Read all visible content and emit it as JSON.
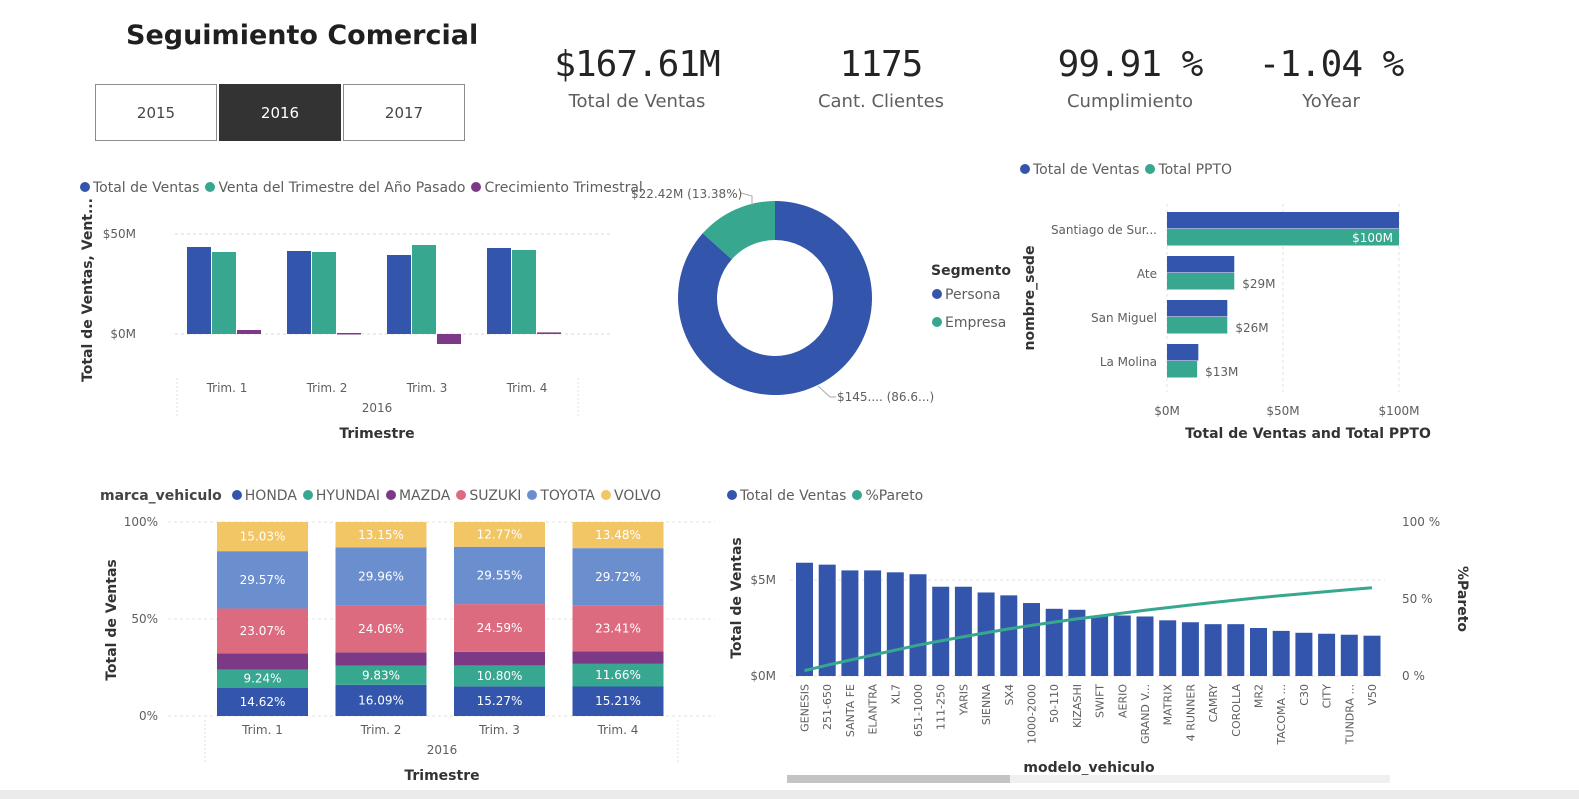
{
  "header": {
    "title": "Seguimiento Comercial"
  },
  "slicer": {
    "options": [
      "2015",
      "2016",
      "2017"
    ],
    "selected": "2016"
  },
  "kpis": [
    {
      "value": "$167.61M",
      "label": "Total de Ventas"
    },
    {
      "value": "1175",
      "label": "Cant. Clientes"
    },
    {
      "value": "99.91 %",
      "label": "Cumplimiento"
    },
    {
      "value": "-1.04 %",
      "label": "YoYear"
    }
  ],
  "colors": {
    "blue": "#3356ac",
    "teal": "#38a78f",
    "purple": "#7c3a86",
    "pink": "#dd6b7f",
    "lightblue": "#6b8fce",
    "yellow": "#f2c664",
    "selected": "#333333"
  },
  "chart_data": [
    {
      "type": "bar",
      "xlabel": "Trimestre",
      "ylabel": "Total de Ventas, Vent...",
      "group_label": "2016",
      "categories": [
        "Trim. 1",
        "Trim. 2",
        "Trim. 3",
        "Trim. 4"
      ],
      "yticks": [
        "$50M",
        "$0M"
      ],
      "ylim": [
        -10,
        60
      ],
      "series": [
        {
          "name": "Total de Ventas",
          "values": [
            43.5,
            41.5,
            39.5,
            43
          ],
          "color": "#3356ac"
        },
        {
          "name": "Venta del Trimestre del Año Pasado",
          "values": [
            41,
            41,
            44.5,
            42
          ],
          "color": "#38a78f"
        },
        {
          "name": "Crecimiento Trimestral",
          "values": [
            2,
            0.5,
            -5,
            0.8
          ],
          "color": "#7c3a86"
        }
      ]
    },
    {
      "type": "pie",
      "legend_title": "Segmento",
      "slices": [
        {
          "name": "Persona",
          "value": 86.62,
          "label": "$145.... (86.6...)",
          "color": "#3356ac"
        },
        {
          "name": "Empresa",
          "value": 13.38,
          "label": "$22.42M (13.38%)",
          "color": "#38a78f"
        }
      ]
    },
    {
      "type": "bar",
      "orientation": "horizontal",
      "xlabel": "Total de Ventas and Total PPTO",
      "ylabel": "nombre_sede",
      "categories": [
        "Santiago de Sur...",
        "Ate",
        "San Miguel",
        "La Molina"
      ],
      "xticks": [
        "$0M",
        "$50M",
        "$100M"
      ],
      "xlim": [
        0,
        100
      ],
      "series": [
        {
          "name": "Total de Ventas",
          "values": [
            100,
            29,
            26,
            13.5
          ],
          "color": "#3356ac"
        },
        {
          "name": "Total PPTO",
          "values": [
            100,
            29,
            26,
            13
          ],
          "labels": [
            "$100M",
            "$29M",
            "$26M",
            "$13M"
          ],
          "color": "#38a78f"
        }
      ]
    },
    {
      "type": "bar",
      "stacked": "percent",
      "legend_title": "marca_vehiculo",
      "xlabel": "Trimestre",
      "ylabel": "Total de Ventas",
      "group_label": "2016",
      "categories": [
        "Trim. 1",
        "Trim. 2",
        "Trim. 3",
        "Trim. 4"
      ],
      "yticks": [
        "100%",
        "50%",
        "0%"
      ],
      "series": [
        {
          "name": "HONDA",
          "values": [
            14.62,
            16.09,
            15.27,
            15.21
          ],
          "labels": [
            "14.62%",
            "16.09%",
            "15.27%",
            "15.21%"
          ],
          "color": "#3356ac"
        },
        {
          "name": "HYUNDAI",
          "values": [
            9.24,
            9.83,
            10.8,
            11.66
          ],
          "labels": [
            "9.24%",
            "9.83%",
            "10.80%",
            "11.66%"
          ],
          "color": "#38a78f"
        },
        {
          "name": "MAZDA",
          "values": [
            8.47,
            6.91,
            7.02,
            6.52
          ],
          "labels": [
            "",
            "",
            "",
            ""
          ],
          "color": "#7c3a86"
        },
        {
          "name": "SUZUKI",
          "values": [
            23.07,
            24.06,
            24.59,
            23.41
          ],
          "labels": [
            "23.07%",
            "24.06%",
            "24.59%",
            "23.41%"
          ],
          "color": "#dd6b7f"
        },
        {
          "name": "TOYOTA",
          "values": [
            29.57,
            29.96,
            29.55,
            29.72
          ],
          "labels": [
            "29.57%",
            "29.96%",
            "29.55%",
            "29.72%"
          ],
          "color": "#6b8fce"
        },
        {
          "name": "VOLVO",
          "values": [
            15.03,
            13.15,
            12.77,
            13.48
          ],
          "labels": [
            "15.03%",
            "13.15%",
            "12.77%",
            "13.48%"
          ],
          "color": "#f2c664"
        }
      ]
    },
    {
      "type": "bar",
      "combo_line": true,
      "xlabel": "modelo_vehiculo",
      "ylabel": "Total de Ventas",
      "y2label": "%Pareto",
      "yticks": [
        "$5M",
        "$0M"
      ],
      "y2ticks": [
        "100 %",
        "50 %",
        "0 %"
      ],
      "ylim": [
        0,
        8.5
      ],
      "categories": [
        "GENESIS",
        "251-650",
        "SANTA FE",
        "ELANTRA",
        "XL7",
        "651-1000",
        "111-250",
        "YARIS",
        "SIENNA",
        "SX4",
        "1000-2000",
        "50-110",
        "KIZASHI",
        "SWIFT",
        "AERIO",
        "GRAND V...",
        "MATRIX",
        "4 RUNNER",
        "CAMRY",
        "COROLLA",
        "MR2",
        "TACOMA ...",
        "C30",
        "CITY",
        "TUNDRA ...",
        "V50"
      ],
      "series": [
        {
          "name": "Total de Ventas",
          "values": [
            5.9,
            5.8,
            5.5,
            5.5,
            5.4,
            5.3,
            4.65,
            4.65,
            4.35,
            4.2,
            3.8,
            3.5,
            3.45,
            3.15,
            3.15,
            3.1,
            2.9,
            2.8,
            2.7,
            2.7,
            2.5,
            2.35,
            2.25,
            2.2,
            2.15,
            2.1
          ],
          "color": "#3356ac"
        },
        {
          "name": "%Pareto",
          "values": [
            3.5,
            7,
            10.3,
            13.6,
            16.8,
            20,
            22.8,
            25.5,
            28.1,
            30.6,
            32.9,
            35,
            37.1,
            38.9,
            40.8,
            42.7,
            44.4,
            46.1,
            47.7,
            49.3,
            50.8,
            52.2,
            53.5,
            54.8,
            56.1,
            57.3
          ],
          "color": "#38a78f"
        }
      ]
    }
  ]
}
